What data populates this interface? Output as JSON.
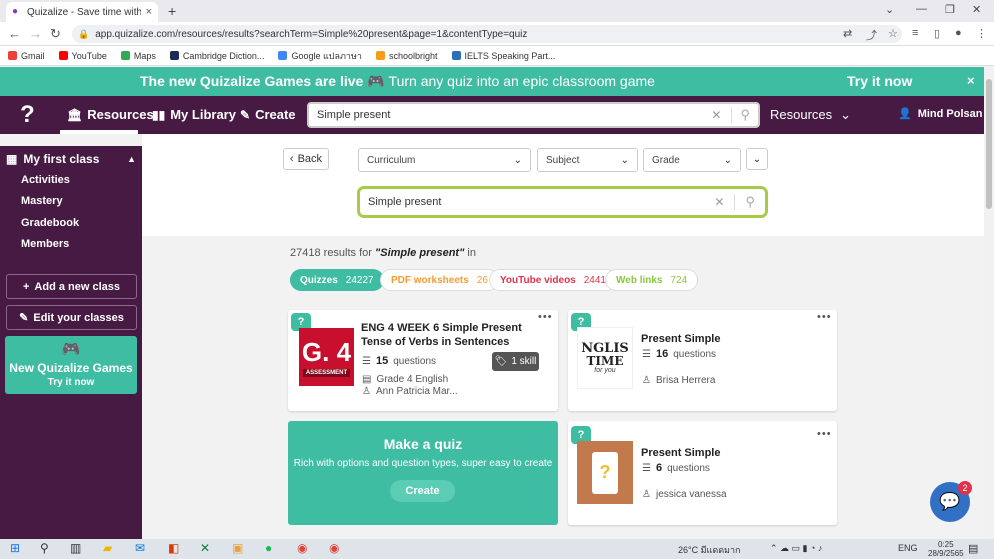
{
  "browser": {
    "tab_title": "Quizalize - Save time with person",
    "new_tab": "+",
    "url": "app.quizalize.com/resources/results?searchTerm=Simple%20present&page=1&contentType=quiz",
    "bookmarks": [
      {
        "label": "Gmail",
        "color": "#ea4335"
      },
      {
        "label": "YouTube",
        "color": "#ff0000"
      },
      {
        "label": "Maps",
        "color": "#34a853"
      },
      {
        "label": "Cambridge Diction...",
        "color": "#1d2a57"
      },
      {
        "label": "Google แปลภาษา",
        "color": "#4285f4"
      },
      {
        "label": "schoolbright",
        "color": "#f59c1a"
      },
      {
        "label": "IELTS Speaking Part...",
        "color": "#2c6fbb"
      }
    ]
  },
  "banner": {
    "headline": "The new Quizalize Games are live",
    "game_icon": "🎮",
    "subline": "Turn any quiz into an epic classroom game",
    "cta": "Try it now",
    "close": "×"
  },
  "topnav": {
    "logo": "?",
    "items": [
      {
        "icon": "🏛",
        "label": "Resources"
      },
      {
        "icon": "▮▮",
        "label": "My Library"
      },
      {
        "icon": "✎",
        "label": "Create"
      }
    ],
    "search_value": "Simple present",
    "resources_dropdown": "Resources",
    "user_name": "Mind Polsan"
  },
  "sidebar": {
    "class_name": "My first class",
    "items": [
      "Activities",
      "Mastery",
      "Gradebook",
      "Members"
    ],
    "add_class": "Add a new class",
    "edit_classes": "Edit your classes",
    "games_title": "New Quizalize Games",
    "games_cta": "Try it now"
  },
  "filters": {
    "back": "Back",
    "curriculum": "Curriculum",
    "subject": "Subject",
    "grade": "Grade",
    "search_value": "Simple present"
  },
  "results": {
    "count": "27418",
    "text_before": "results for",
    "term": "\"Simple present\"",
    "text_after": "in",
    "tabs": [
      {
        "label": "Quizzes",
        "count": "24227",
        "active": true
      },
      {
        "label": "PDF worksheets",
        "count": "26",
        "active": false
      },
      {
        "label": "YouTube videos",
        "count": "2441",
        "active": false
      },
      {
        "label": "Web links",
        "count": "724",
        "active": false
      }
    ]
  },
  "cards": [
    {
      "title": "ENG 4 WEEK 6 Simple Present Tense of Verbs in Sentences",
      "questions": "15",
      "questions_label": "questions",
      "skill": "1 skill",
      "grade_subject": "Grade 4 English",
      "author": "Ann Patricia Mar...",
      "thumb_big": "G. 4",
      "thumb_small": "ASSESSMENT"
    },
    {
      "title": "Present Simple",
      "questions": "16",
      "questions_label": "questions",
      "author": "Brisa Herrera",
      "thumb_a": "NGLIS",
      "thumb_b": "TIME",
      "thumb_c": "for you"
    },
    {
      "title": "Present Simple",
      "questions": "6",
      "questions_label": "questions",
      "author": "jessica vanessa",
      "thumb": "?"
    }
  ],
  "make_quiz": {
    "title": "Make a quiz",
    "text": "Rich with options and question types, super easy to create",
    "button": "Create"
  },
  "chat": {
    "badge": "2"
  },
  "taskbar": {
    "weather": "26°C มีแดดมาก",
    "lang": "ENG",
    "time": "0:25",
    "date": "28/9/2565"
  },
  "colors": {
    "accent": "#3fbda3",
    "nav": "#461a42",
    "search_border": "#a6cb48",
    "pdf": "#f39c33",
    "youtube": "#e0324c",
    "weblinks": "#8cc63f"
  }
}
